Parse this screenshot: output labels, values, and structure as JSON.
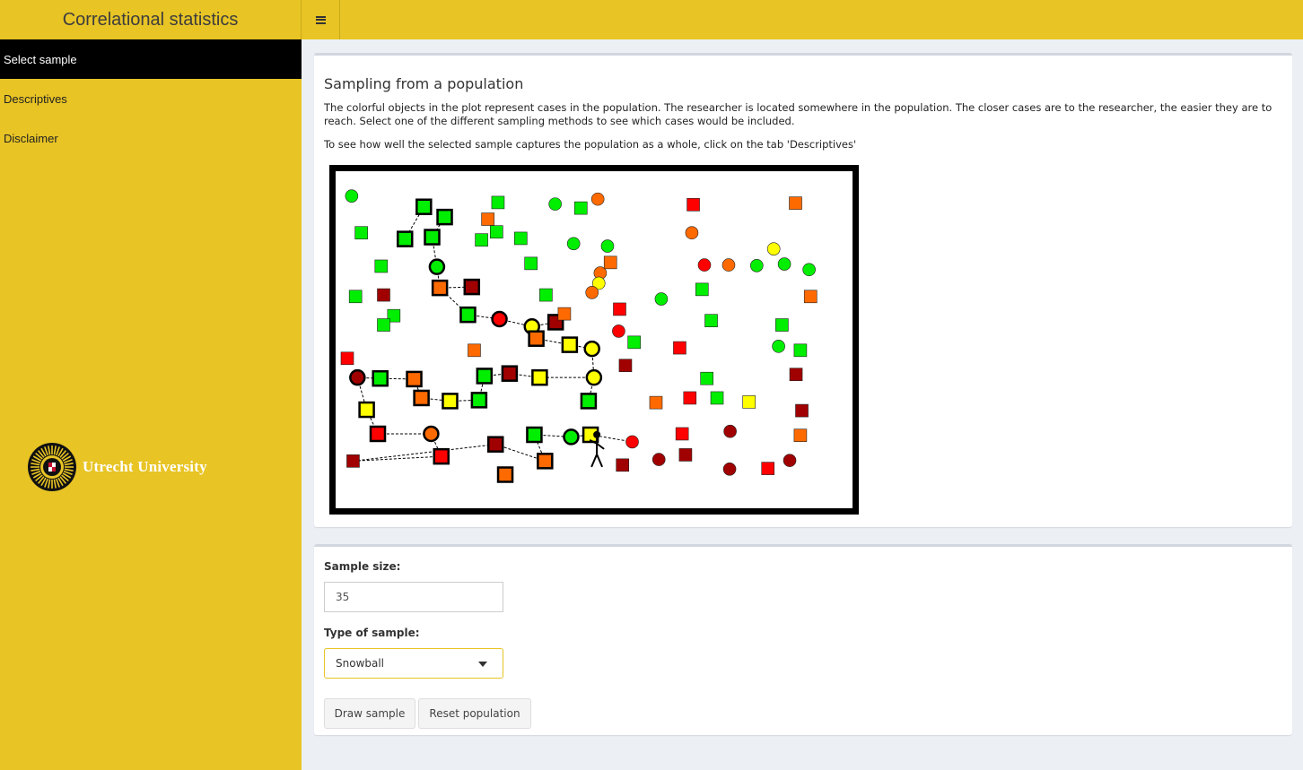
{
  "header": {
    "title": "Correlational statistics",
    "menu_icon": "hamburger-icon"
  },
  "sidebar": {
    "items": [
      {
        "label": "Select sample",
        "active": true
      },
      {
        "label": "Descriptives",
        "active": false
      },
      {
        "label": "Disclaimer",
        "active": false
      }
    ],
    "logo_text": "Utrecht University"
  },
  "main": {
    "title": "Sampling from a population",
    "paragraph1": "The colorful objects in the plot represent cases in the population. The researcher is located somewhere in the population. The closer cases are to the researcher, the easier they are to reach. Select one of the different sampling methods to see which cases would be included.",
    "paragraph2": "To see how well the selected sample captures the population as a whole, click on the tab 'Descriptives'"
  },
  "controls": {
    "sample_size_label": "Sample size:",
    "sample_size_value": "35",
    "type_label": "Type of sample:",
    "type_value": "Snowball",
    "draw_button": "Draw sample",
    "reset_button": "Reset population"
  },
  "colors": {
    "brand": "#e8c425",
    "green": "#00ee00",
    "yellow": "#ffff00",
    "orange": "#ff6a00",
    "red": "#ff0000",
    "dark_red": "#a00000"
  },
  "chart_data": {
    "type": "scatter",
    "title": "",
    "xlabel": "",
    "ylabel": "",
    "grid": false,
    "legend": "none",
    "researcher_icon": "stick-figure-icon",
    "points": [
      {
        "x": 0.9,
        "y": 94.3,
        "shape": "circle",
        "color": "green",
        "sampled": false
      },
      {
        "x": 15.8,
        "y": 90.8,
        "shape": "square",
        "color": "green",
        "sampled": true
      },
      {
        "x": 20.1,
        "y": 87.5,
        "shape": "square",
        "color": "green",
        "sampled": true
      },
      {
        "x": 2.9,
        "y": 82.4,
        "shape": "square",
        "color": "green",
        "sampled": false
      },
      {
        "x": 11.9,
        "y": 80.4,
        "shape": "square",
        "color": "green",
        "sampled": true
      },
      {
        "x": 17.5,
        "y": 81.0,
        "shape": "square",
        "color": "green",
        "sampled": true
      },
      {
        "x": 31.1,
        "y": 92.2,
        "shape": "square",
        "color": "green",
        "sampled": false
      },
      {
        "x": 42.9,
        "y": 91.7,
        "shape": "circle",
        "color": "green",
        "sampled": false
      },
      {
        "x": 51.7,
        "y": 93.3,
        "shape": "circle",
        "color": "orange",
        "sampled": false
      },
      {
        "x": 29.0,
        "y": 86.8,
        "shape": "square",
        "color": "orange",
        "sampled": false
      },
      {
        "x": 48.2,
        "y": 90.4,
        "shape": "square",
        "color": "green",
        "sampled": false
      },
      {
        "x": 30.8,
        "y": 82.7,
        "shape": "square",
        "color": "green",
        "sampled": false
      },
      {
        "x": 35.8,
        "y": 80.6,
        "shape": "square",
        "color": "green",
        "sampled": false
      },
      {
        "x": 46.7,
        "y": 78.9,
        "shape": "circle",
        "color": "green",
        "sampled": false
      },
      {
        "x": 53.7,
        "y": 78.1,
        "shape": "circle",
        "color": "green",
        "sampled": false
      },
      {
        "x": 27.7,
        "y": 80.1,
        "shape": "square",
        "color": "green",
        "sampled": false
      },
      {
        "x": 71.4,
        "y": 91.5,
        "shape": "square",
        "color": "red",
        "sampled": false
      },
      {
        "x": 92.5,
        "y": 92.0,
        "shape": "square",
        "color": "orange",
        "sampled": false
      },
      {
        "x": 71.1,
        "y": 82.4,
        "shape": "circle",
        "color": "orange",
        "sampled": false
      },
      {
        "x": 88.0,
        "y": 77.2,
        "shape": "circle",
        "color": "yellow",
        "sampled": false
      },
      {
        "x": 7.0,
        "y": 71.6,
        "shape": "square",
        "color": "green",
        "sampled": false
      },
      {
        "x": 18.5,
        "y": 71.4,
        "shape": "circle",
        "color": "green",
        "sampled": true
      },
      {
        "x": 37.9,
        "y": 72.5,
        "shape": "square",
        "color": "green",
        "sampled": false
      },
      {
        "x": 52.2,
        "y": 69.4,
        "shape": "circle",
        "color": "orange",
        "sampled": false
      },
      {
        "x": 54.3,
        "y": 72.8,
        "shape": "square",
        "color": "orange",
        "sampled": false
      },
      {
        "x": 73.7,
        "y": 72.0,
        "shape": "circle",
        "color": "red",
        "sampled": false
      },
      {
        "x": 78.7,
        "y": 72.0,
        "shape": "circle",
        "color": "orange",
        "sampled": false
      },
      {
        "x": 84.5,
        "y": 71.8,
        "shape": "circle",
        "color": "green",
        "sampled": false
      },
      {
        "x": 90.2,
        "y": 72.3,
        "shape": "circle",
        "color": "green",
        "sampled": false
      },
      {
        "x": 95.3,
        "y": 70.5,
        "shape": "circle",
        "color": "green",
        "sampled": false
      },
      {
        "x": 1.7,
        "y": 61.8,
        "shape": "square",
        "color": "green",
        "sampled": false
      },
      {
        "x": 7.5,
        "y": 62.3,
        "shape": "square",
        "color": "dark_red",
        "sampled": false
      },
      {
        "x": 19.1,
        "y": 64.6,
        "shape": "square",
        "color": "orange",
        "sampled": true
      },
      {
        "x": 25.7,
        "y": 64.9,
        "shape": "square",
        "color": "dark_red",
        "sampled": true
      },
      {
        "x": 41.0,
        "y": 62.3,
        "shape": "square",
        "color": "green",
        "sampled": false
      },
      {
        "x": 51.9,
        "y": 66.1,
        "shape": "circle",
        "color": "yellow",
        "sampled": false
      },
      {
        "x": 50.5,
        "y": 63.1,
        "shape": "circle",
        "color": "orange",
        "sampled": false
      },
      {
        "x": 64.8,
        "y": 61.0,
        "shape": "circle",
        "color": "green",
        "sampled": false
      },
      {
        "x": 73.2,
        "y": 64.1,
        "shape": "square",
        "color": "green",
        "sampled": false
      },
      {
        "x": 95.6,
        "y": 61.8,
        "shape": "square",
        "color": "orange",
        "sampled": false
      },
      {
        "x": 9.6,
        "y": 55.6,
        "shape": "square",
        "color": "green",
        "sampled": false
      },
      {
        "x": 7.5,
        "y": 52.6,
        "shape": "square",
        "color": "green",
        "sampled": false
      },
      {
        "x": 24.9,
        "y": 55.9,
        "shape": "square",
        "color": "green",
        "sampled": true
      },
      {
        "x": 31.4,
        "y": 54.5,
        "shape": "circle",
        "color": "red",
        "sampled": true
      },
      {
        "x": 38.1,
        "y": 52.1,
        "shape": "circle",
        "color": "yellow",
        "sampled": true
      },
      {
        "x": 43.0,
        "y": 53.5,
        "shape": "square",
        "color": "dark_red",
        "sampled": true
      },
      {
        "x": 39.0,
        "y": 48.2,
        "shape": "square",
        "color": "orange",
        "sampled": true
      },
      {
        "x": 44.8,
        "y": 56.2,
        "shape": "square",
        "color": "orange",
        "sampled": false
      },
      {
        "x": 56.2,
        "y": 57.7,
        "shape": "square",
        "color": "red",
        "sampled": false
      },
      {
        "x": 56.0,
        "y": 50.6,
        "shape": "circle",
        "color": "red",
        "sampled": false
      },
      {
        "x": 75.1,
        "y": 54.0,
        "shape": "square",
        "color": "green",
        "sampled": false
      },
      {
        "x": 89.7,
        "y": 52.6,
        "shape": "square",
        "color": "green",
        "sampled": false
      },
      {
        "x": 0.0,
        "y": 41.8,
        "shape": "square",
        "color": "red",
        "sampled": false
      },
      {
        "x": 26.2,
        "y": 44.4,
        "shape": "square",
        "color": "orange",
        "sampled": false
      },
      {
        "x": 45.9,
        "y": 46.2,
        "shape": "square",
        "color": "yellow",
        "sampled": true
      },
      {
        "x": 50.5,
        "y": 44.9,
        "shape": "circle",
        "color": "yellow",
        "sampled": true
      },
      {
        "x": 59.2,
        "y": 47.0,
        "shape": "square",
        "color": "green",
        "sampled": false
      },
      {
        "x": 57.4,
        "y": 39.5,
        "shape": "square",
        "color": "dark_red",
        "sampled": false
      },
      {
        "x": 68.6,
        "y": 45.2,
        "shape": "square",
        "color": "red",
        "sampled": false
      },
      {
        "x": 89.0,
        "y": 45.7,
        "shape": "circle",
        "color": "green",
        "sampled": false
      },
      {
        "x": 93.5,
        "y": 44.4,
        "shape": "square",
        "color": "green",
        "sampled": false
      },
      {
        "x": 2.1,
        "y": 35.6,
        "shape": "circle",
        "color": "dark_red",
        "sampled": true
      },
      {
        "x": 6.8,
        "y": 35.3,
        "shape": "square",
        "color": "green",
        "sampled": true
      },
      {
        "x": 13.8,
        "y": 35.1,
        "shape": "square",
        "color": "orange",
        "sampled": true
      },
      {
        "x": 28.3,
        "y": 36.1,
        "shape": "square",
        "color": "green",
        "sampled": true
      },
      {
        "x": 33.5,
        "y": 36.9,
        "shape": "square",
        "color": "dark_red",
        "sampled": true
      },
      {
        "x": 39.7,
        "y": 35.6,
        "shape": "square",
        "color": "yellow",
        "sampled": true
      },
      {
        "x": 50.9,
        "y": 35.6,
        "shape": "circle",
        "color": "yellow",
        "sampled": true
      },
      {
        "x": 74.2,
        "y": 35.3,
        "shape": "square",
        "color": "green",
        "sampled": false
      },
      {
        "x": 92.6,
        "y": 36.6,
        "shape": "square",
        "color": "dark_red",
        "sampled": false
      },
      {
        "x": 15.3,
        "y": 29.0,
        "shape": "square",
        "color": "orange",
        "sampled": true
      },
      {
        "x": 21.2,
        "y": 28.0,
        "shape": "square",
        "color": "yellow",
        "sampled": true
      },
      {
        "x": 27.2,
        "y": 28.3,
        "shape": "square",
        "color": "green",
        "sampled": true
      },
      {
        "x": 49.8,
        "y": 28.0,
        "shape": "square",
        "color": "green",
        "sampled": true
      },
      {
        "x": 63.7,
        "y": 27.5,
        "shape": "square",
        "color": "orange",
        "sampled": false
      },
      {
        "x": 70.7,
        "y": 29.0,
        "shape": "square",
        "color": "red",
        "sampled": false
      },
      {
        "x": 76.3,
        "y": 29.0,
        "shape": "square",
        "color": "green",
        "sampled": false
      },
      {
        "x": 82.9,
        "y": 27.7,
        "shape": "square",
        "color": "yellow",
        "sampled": false
      },
      {
        "x": 93.8,
        "y": 24.9,
        "shape": "square",
        "color": "dark_red",
        "sampled": false
      },
      {
        "x": 4.0,
        "y": 25.2,
        "shape": "square",
        "color": "yellow",
        "sampled": true
      },
      {
        "x": 6.3,
        "y": 17.4,
        "shape": "square",
        "color": "red",
        "sampled": true
      },
      {
        "x": 17.3,
        "y": 17.4,
        "shape": "circle",
        "color": "orange",
        "sampled": true
      },
      {
        "x": 38.6,
        "y": 17.1,
        "shape": "square",
        "color": "green",
        "sampled": true
      },
      {
        "x": 46.2,
        "y": 16.4,
        "shape": "circle",
        "color": "green",
        "sampled": true
      },
      {
        "x": 50.2,
        "y": 17.1,
        "shape": "square",
        "color": "yellow",
        "sampled": true
      },
      {
        "x": 58.8,
        "y": 14.8,
        "shape": "circle",
        "color": "red",
        "sampled": false
      },
      {
        "x": 69.1,
        "y": 17.4,
        "shape": "square",
        "color": "red",
        "sampled": false
      },
      {
        "x": 79.0,
        "y": 18.2,
        "shape": "circle",
        "color": "dark_red",
        "sampled": false
      },
      {
        "x": 93.5,
        "y": 16.9,
        "shape": "square",
        "color": "orange",
        "sampled": false
      },
      {
        "x": 19.4,
        "y": 10.1,
        "shape": "square",
        "color": "red",
        "sampled": true
      },
      {
        "x": 30.6,
        "y": 14.0,
        "shape": "square",
        "color": "dark_red",
        "sampled": true
      },
      {
        "x": 40.8,
        "y": 8.6,
        "shape": "square",
        "color": "orange",
        "sampled": true
      },
      {
        "x": 1.2,
        "y": 8.6,
        "shape": "square",
        "color": "dark_red",
        "sampled": false
      },
      {
        "x": 32.6,
        "y": 4.2,
        "shape": "square",
        "color": "orange",
        "sampled": true
      },
      {
        "x": 56.8,
        "y": 7.3,
        "shape": "square",
        "color": "dark_red",
        "sampled": false
      },
      {
        "x": 64.3,
        "y": 9.1,
        "shape": "circle",
        "color": "dark_red",
        "sampled": false
      },
      {
        "x": 69.8,
        "y": 10.6,
        "shape": "square",
        "color": "dark_red",
        "sampled": false
      },
      {
        "x": 78.9,
        "y": 6.0,
        "shape": "circle",
        "color": "dark_red",
        "sampled": false
      },
      {
        "x": 86.8,
        "y": 6.2,
        "shape": "square",
        "color": "red",
        "sampled": false
      },
      {
        "x": 91.3,
        "y": 8.8,
        "shape": "circle",
        "color": "dark_red",
        "sampled": false
      }
    ],
    "links": [
      [
        1,
        4
      ],
      [
        2,
        5
      ],
      [
        5,
        21
      ],
      [
        21,
        32
      ],
      [
        32,
        33
      ],
      [
        32,
        42
      ],
      [
        42,
        43
      ],
      [
        43,
        44
      ],
      [
        44,
        45
      ],
      [
        44,
        46
      ],
      [
        46,
        54
      ],
      [
        54,
        55
      ],
      [
        55,
        67
      ],
      [
        67,
        66
      ],
      [
        66,
        65
      ],
      [
        65,
        64
      ],
      [
        67,
        73
      ],
      [
        61,
        62
      ],
      [
        62,
        63
      ],
      [
        63,
        70
      ],
      [
        70,
        71
      ],
      [
        71,
        72
      ],
      [
        72,
        64
      ],
      [
        61,
        79
      ],
      [
        79,
        80
      ],
      [
        80,
        81
      ],
      [
        81,
        89
      ],
      [
        89,
        92
      ],
      [
        92,
        90
      ],
      [
        90,
        91
      ],
      [
        91,
        82
      ],
      [
        82,
        83
      ],
      [
        83,
        84
      ],
      [
        84,
        85
      ]
    ],
    "researcher": {
      "x": 51.5,
      "y": 12.5
    }
  }
}
